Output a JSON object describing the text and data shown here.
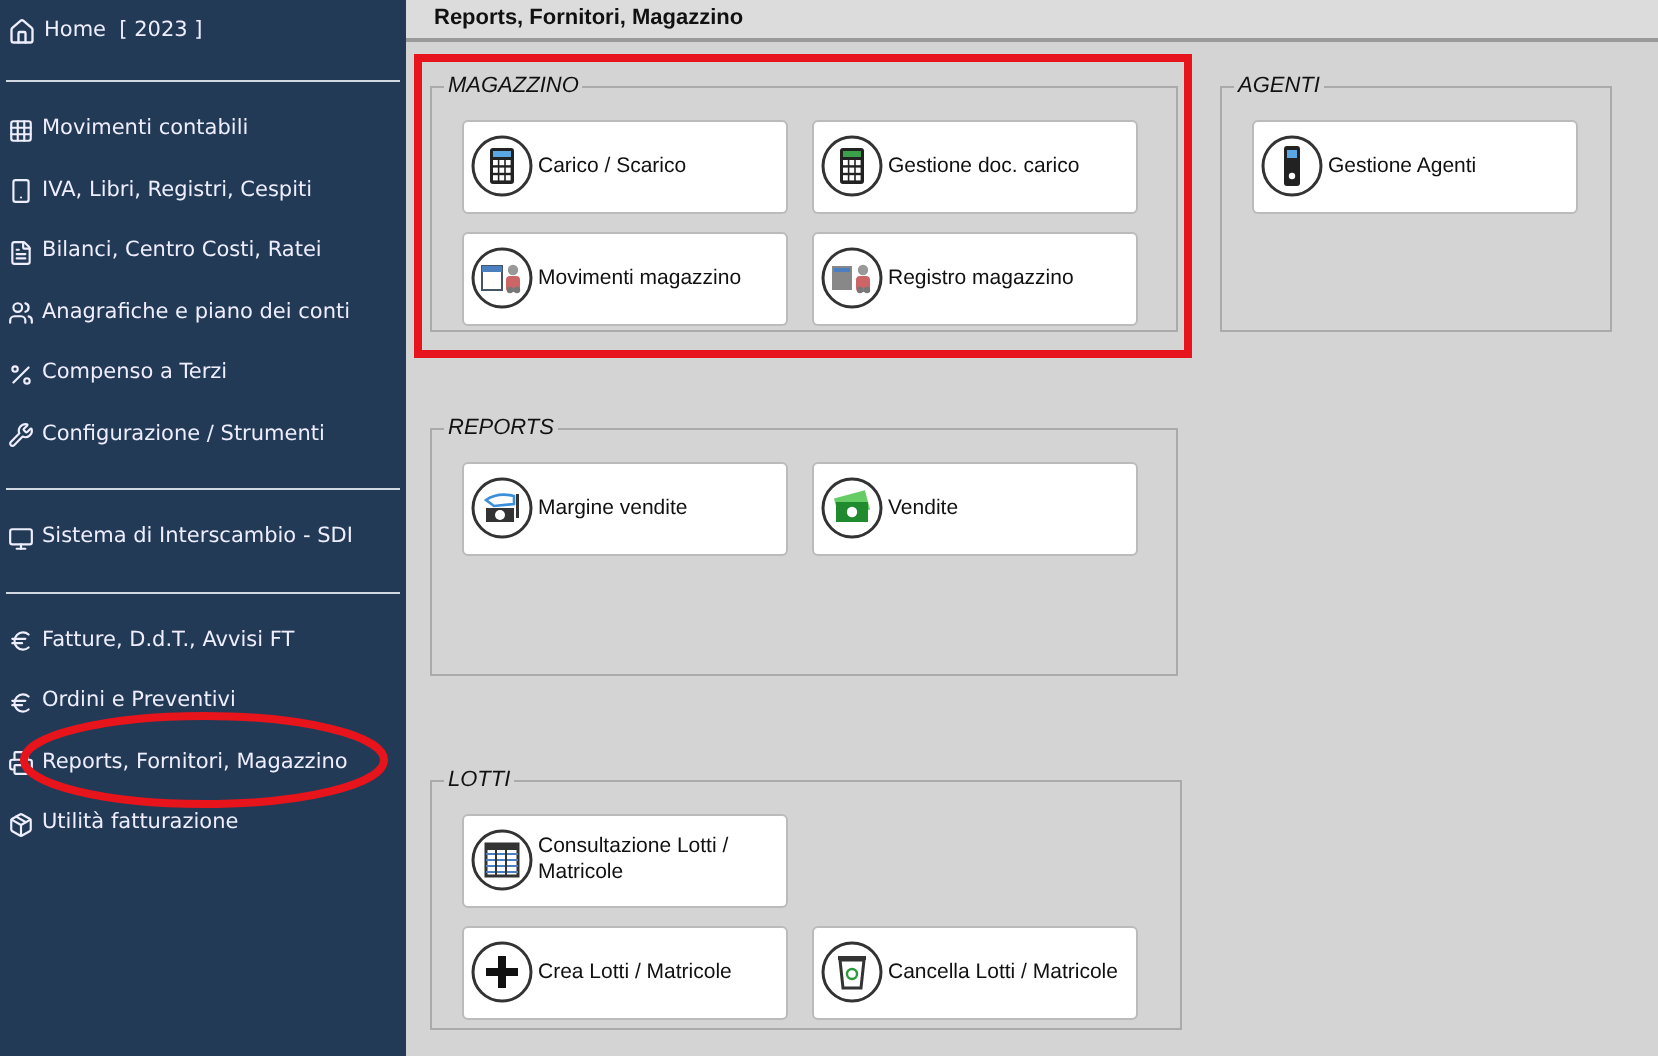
{
  "sidebar": {
    "home": "Home  [ 2023 ]",
    "groups": [
      [
        "Movimenti contabili",
        "IVA, Libri, Registri, Cespiti",
        "Bilanci, Centro Costi, Ratei",
        "Anagrafiche e piano dei conti",
        "Compenso a Terzi",
        "Configurazione / Strumenti"
      ],
      [
        "Sistema di Interscambio - SDI"
      ],
      [
        "Fatture, D.d.T., Avvisi FT",
        "Ordini e Preventivi",
        "Reports, Fornitori, Magazzino",
        "Utilità fatturazione"
      ]
    ]
  },
  "header": {
    "title": "Reports, Fornitori, Magazzino"
  },
  "sections": [
    {
      "title": "MAGAZZINO",
      "rows": [
        [
          "Carico / Scarico",
          "Gestione doc. carico"
        ],
        [
          "Movimenti magazzino",
          "Registro magazzino"
        ]
      ]
    },
    {
      "title": "AGENTI",
      "rows": [
        [
          "Gestione Agenti"
        ]
      ]
    },
    {
      "title": "REPORTS",
      "rows": [
        [
          "Margine vendite",
          "Vendite"
        ]
      ]
    },
    {
      "title": "LOTTI",
      "rows": [
        [
          "Consultazione Lotti / Matricole"
        ],
        [
          "Crea Lotti / Matricole",
          "Cancella Lotti / Matricole"
        ]
      ]
    }
  ]
}
